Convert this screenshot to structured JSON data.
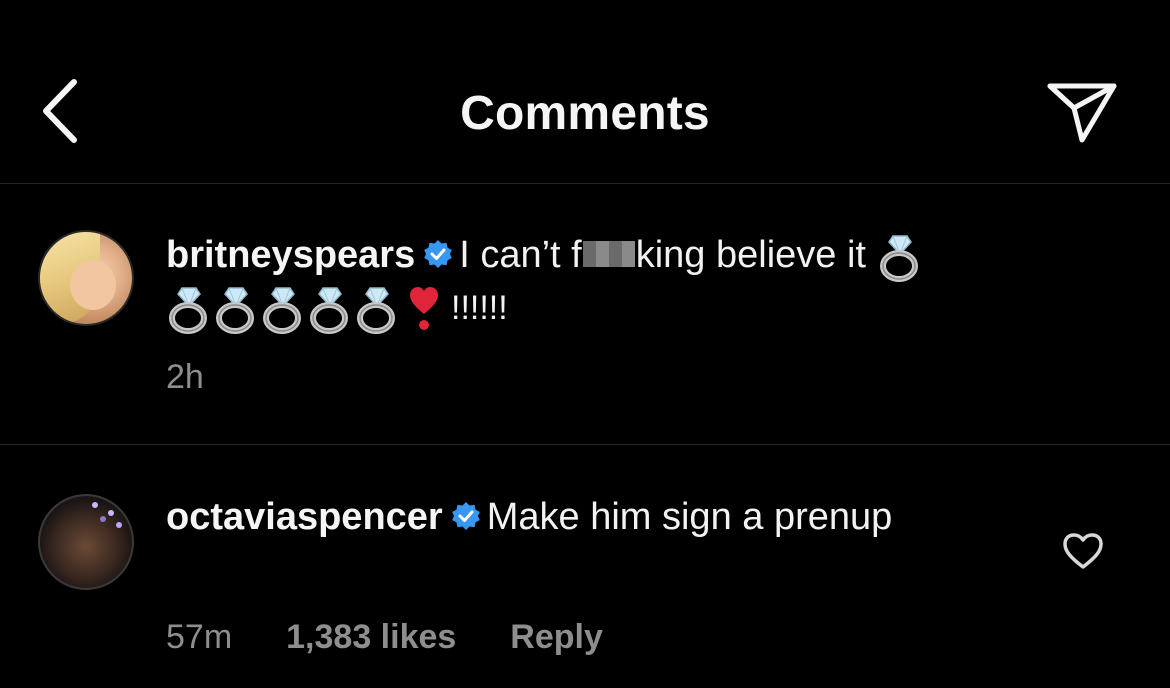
{
  "header": {
    "title": "Comments"
  },
  "comments": [
    {
      "username": "britneyspears",
      "verified": true,
      "text_before": "I can’t f",
      "text_after": "king believe it",
      "ring_count": 6,
      "emoji_after": "heart",
      "exclaim": "!!!!!!",
      "time": "2h"
    },
    {
      "username": "octaviaspencer",
      "verified": true,
      "text": "Make him sign a prenup",
      "time": "57m",
      "likes": "1,383 likes",
      "reply": "Reply"
    }
  ],
  "colors": {
    "background": "#000000",
    "text": "#f2f2f2",
    "meta": "#8e8e8e",
    "verified_badge": "#3897f0",
    "divider": "#262626"
  }
}
